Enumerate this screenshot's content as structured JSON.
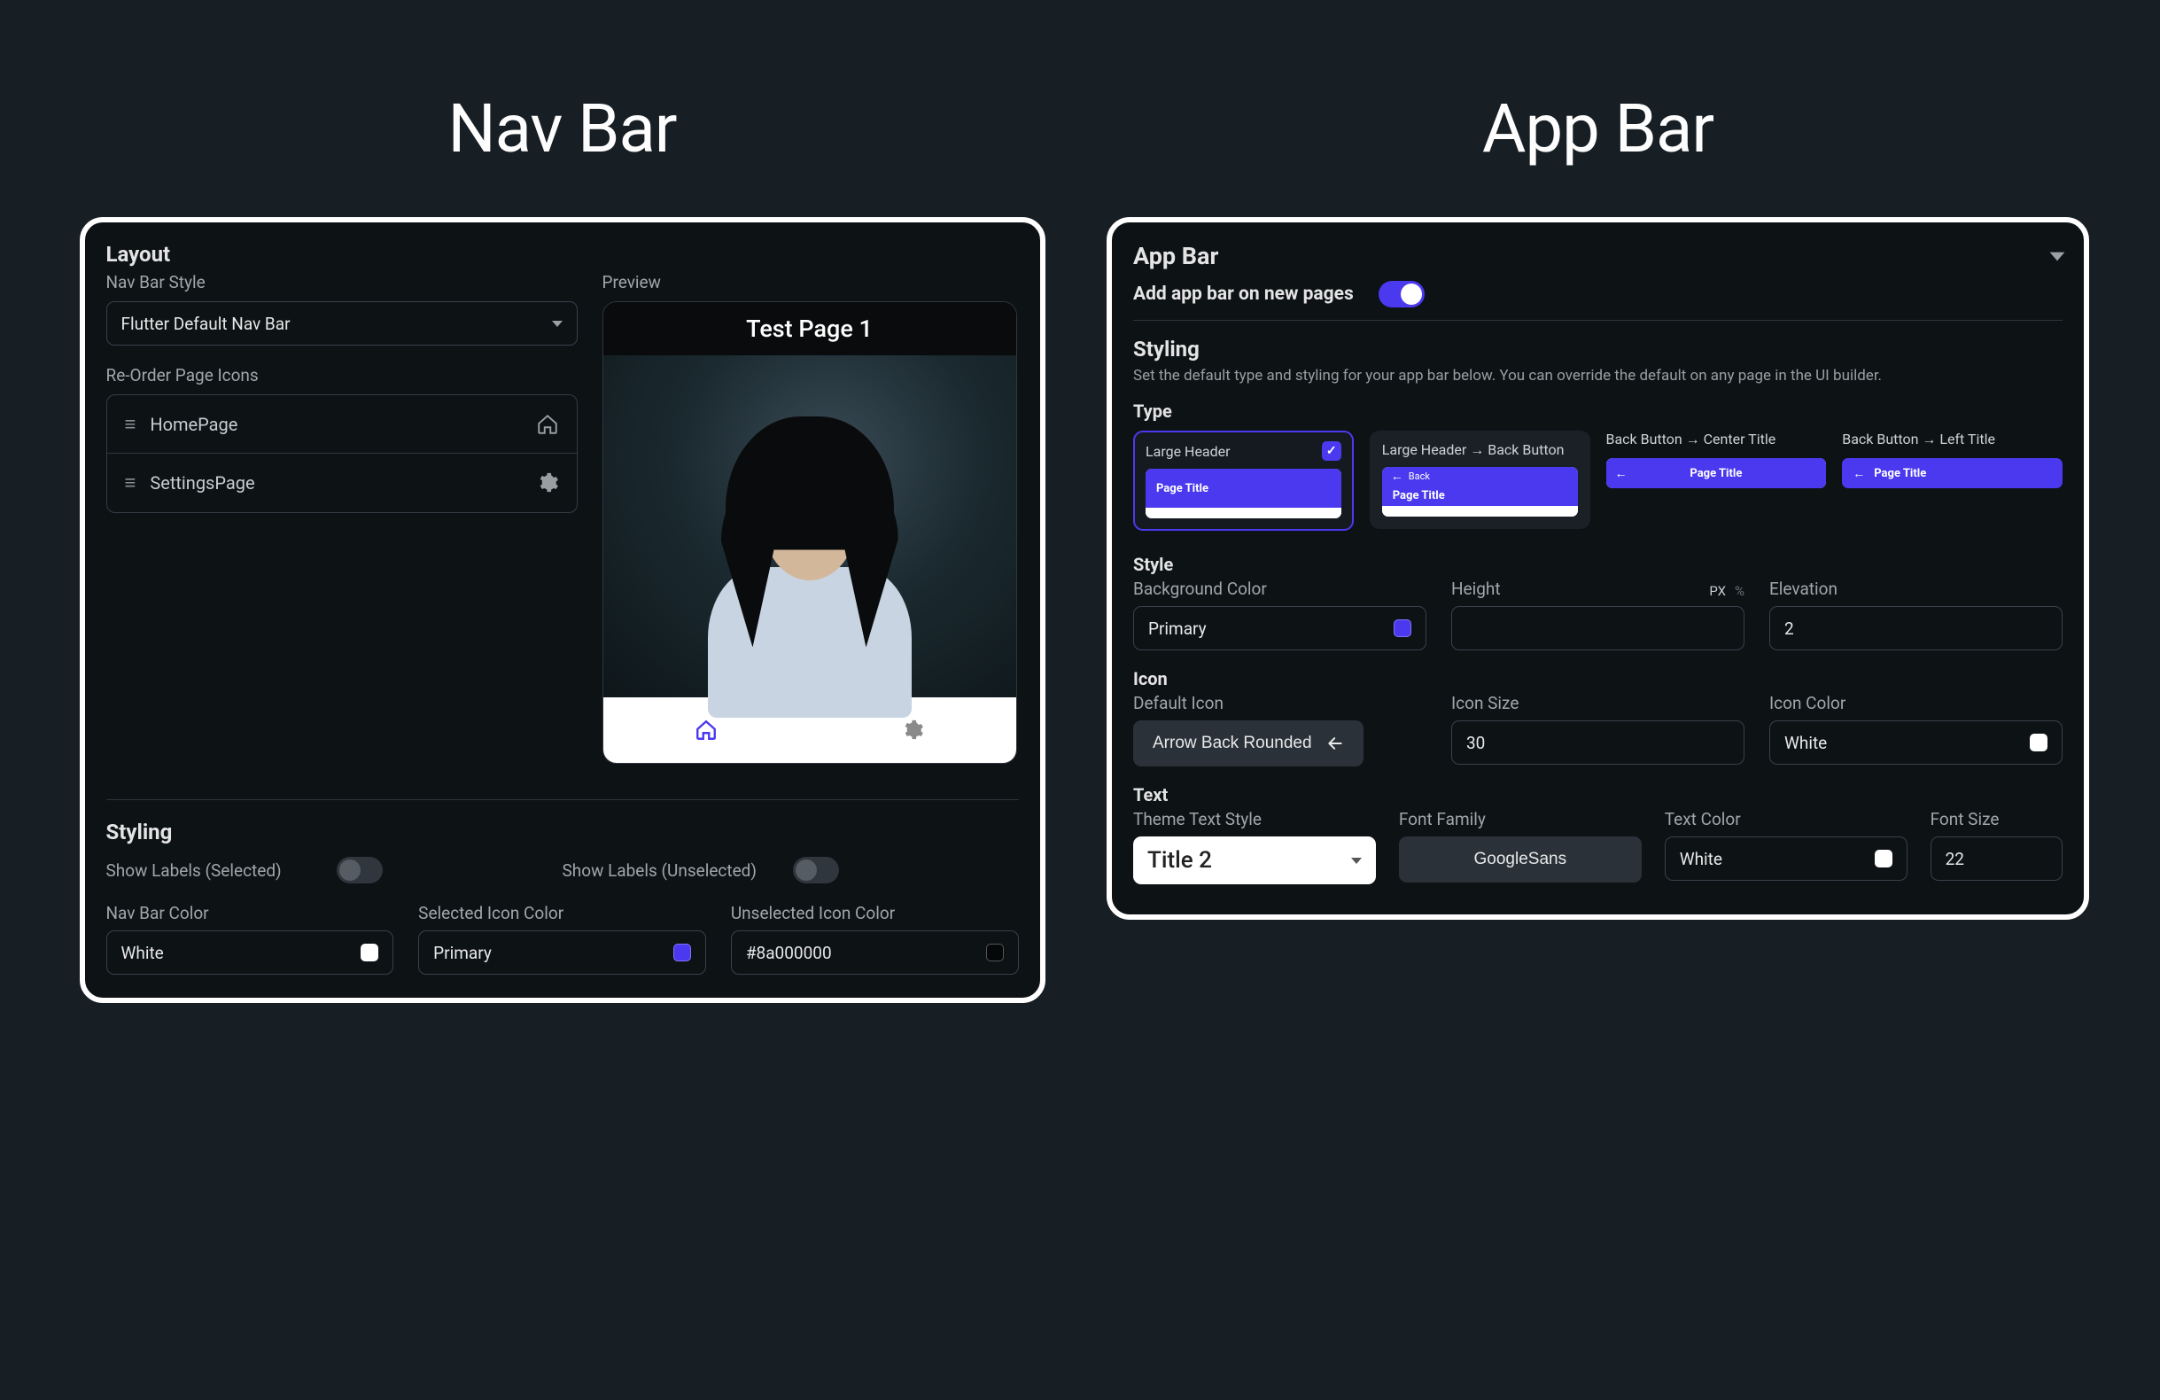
{
  "left_title": "Nav Bar",
  "right_title": "App Bar",
  "nav": {
    "section_layout": "Layout",
    "style_label": "Nav Bar Style",
    "style_value": "Flutter Default Nav Bar",
    "reorder_label": "Re-Order Page Icons",
    "pages": [
      {
        "name": "HomePage",
        "icon": "home"
      },
      {
        "name": "SettingsPage",
        "icon": "gear"
      }
    ],
    "preview_label": "Preview",
    "preview_title": "Test Page 1",
    "section_styling": "Styling",
    "show_labels_selected_label": "Show Labels (Selected)",
    "show_labels_selected": false,
    "show_labels_unselected_label": "Show Labels (Unselected)",
    "show_labels_unselected": false,
    "navbar_color_label": "Nav Bar Color",
    "navbar_color_value": "White",
    "navbar_color_hex": "#ffffff",
    "selected_icon_color_label": "Selected Icon Color",
    "selected_icon_color_value": "Primary",
    "selected_icon_color_hex": "#4b39ef",
    "unselected_icon_color_label": "Unselected Icon Color",
    "unselected_icon_color_value": "#8a000000",
    "unselected_icon_color_hex": "#000000"
  },
  "appbar": {
    "header": "App Bar",
    "add_label": "Add app bar on new pages",
    "add_on": true,
    "section_styling": "Styling",
    "styling_note": "Set the default type and styling for your app bar below. You can override the default on any page in the UI builder.",
    "type_label": "Type",
    "type_options": [
      "Large Header",
      "Large Header → Back Button",
      "Back Button → Center Title",
      "Back Button → Left Title"
    ],
    "type_preview_title": "Page Title",
    "type_preview_back": "Back",
    "type_selected_index": 0,
    "style_label": "Style",
    "bg_color_label": "Background Color",
    "bg_color_value": "Primary",
    "bg_color_hex": "#4b39ef",
    "height_label": "Height",
    "height_value": "",
    "height_unit_px": "PX",
    "height_unit_pct": "%",
    "elevation_label": "Elevation",
    "elevation_value": "2",
    "icon_label": "Icon",
    "default_icon_label": "Default Icon",
    "default_icon_value": "Arrow Back Rounded",
    "icon_size_label": "Icon Size",
    "icon_size_value": "30",
    "icon_color_label": "Icon Color",
    "icon_color_value": "White",
    "icon_color_hex": "#ffffff",
    "text_label": "Text",
    "theme_text_style_label": "Theme Text Style",
    "theme_text_style_value": "Title 2",
    "font_family_label": "Font Family",
    "font_family_value": "GoogleSans",
    "text_color_label": "Text Color",
    "text_color_value": "White",
    "text_color_hex": "#ffffff",
    "font_size_label": "Font Size",
    "font_size_value": "22"
  }
}
